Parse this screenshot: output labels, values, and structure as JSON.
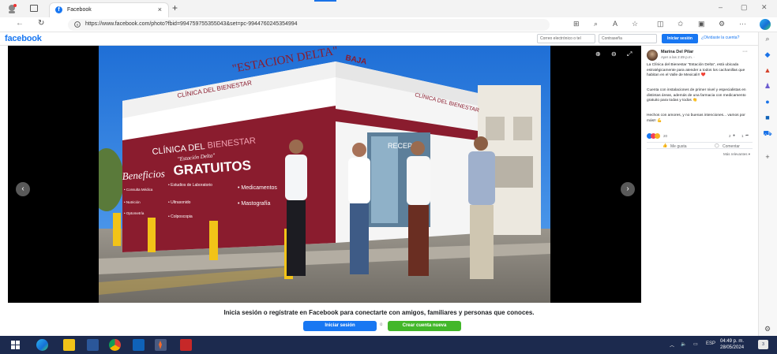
{
  "browser": {
    "tab_title": "Facebook",
    "tab_close": "×",
    "new_tab": "+",
    "url": "https://www.facebook.com/photo?fbid=994759755355043&set=pc-9944760245354994",
    "minimize": "–",
    "restore": "▢",
    "close": "✕"
  },
  "facebook_bar": {
    "logo": "facebook",
    "email_placeholder": "Correo electrónico o tel",
    "password_placeholder": "Contraseña",
    "login_button": "Iniciar sesión",
    "forgot_link": "¿Olvidaste la cuenta?"
  },
  "post": {
    "author": "Marina Del Pilar",
    "time": "Ayer a las 2:49 p.m. · ",
    "more": "···",
    "paragraph1": "La Clínica del Bienestar \"Estación Delta\", está ubicada estratégicamente para atender a todos los cachanillas que habitan en el Valle de Mexicali!! ❤️",
    "paragraph2": "Cuenta con instalaciones de primer nivel y especialistas en distintas áreas, además de una farmacia con medicamento gratuito para todas y todos 👏",
    "paragraph3": "Hechos con amores, y no buenas intenciones... vamos por más!! 💪",
    "reaction_count": "20",
    "comment_count": "2",
    "share_count": "1",
    "like_label": "Me gusta",
    "comment_label": "Comentar",
    "relevance_label": "Más relevantes ▾"
  },
  "photo": {
    "sign_top": "\"ESTACION DELTA\"",
    "sign_clinic": "CLÍNICA DEL BIENESTAR",
    "sign_clinic2_a": "CLÍNICA DEL",
    "sign_clinic2_b": "BIENESTAR",
    "sign_delta": "\"Estación Delta\"",
    "benefits": "Beneficios",
    "gratuitos": "GRATUITOS",
    "s1": "• Consulta Médica",
    "s2": "• Estudios de Laboratorio",
    "s3": "• Medicamentos",
    "s4": "• Nutrición",
    "s5": "• Ultrasonido",
    "s6": "• Mastografía",
    "s7": "• Optometría",
    "s8": "• Colposcopia",
    "baja": "BAJA",
    "reception": "RECEP",
    "clinica_side": "CLÍNICA DEL BIENESTAR",
    "prev": "‹",
    "next": "›"
  },
  "banner": {
    "text": "Inicia sesión o regístrate en Facebook para conectarte con amigos, familiares y personas que conoces.",
    "login_button": "Iniciar sesión",
    "or": "o",
    "create_button": "Crear cuenta nueva"
  },
  "taskbar": {
    "lang": "ESP",
    "time": "04:49 p. m.",
    "date": "28/05/2024",
    "notif": "3"
  },
  "colors": {
    "facebook_blue": "#1877f2",
    "create_green": "#42b72a",
    "taskbar": "#1c2a4e"
  }
}
